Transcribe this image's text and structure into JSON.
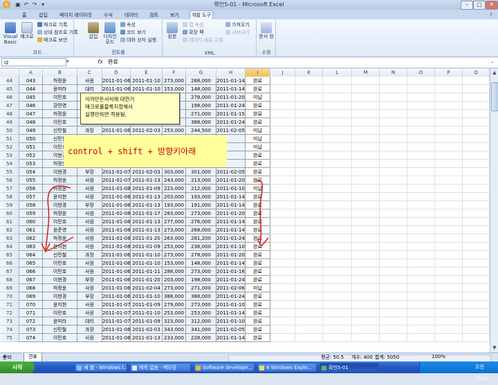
{
  "window": {
    "title": "확인5-01 - Microsoft Excel"
  },
  "tabs": [
    "홈",
    "삽입",
    "페이지 레이아웃",
    "수식",
    "데이터",
    "검토",
    "보기",
    "개발 도구"
  ],
  "active_tab": "개발 도구",
  "ribbon": {
    "code_group": {
      "label": "코드",
      "visual_basic": "Visual Basic",
      "macro": "매크로",
      "record_macro": "매크로 기록",
      "relative_ref": "상대 참조로 기록",
      "macro_security": "매크로 보안"
    },
    "controls_group": {
      "label": "컨트롤",
      "insert": "삽입",
      "design_mode": "디자인 모드",
      "properties": "속성",
      "view_code": "코드 보기",
      "run_dialog": "대화 상자 실행"
    },
    "xml_group": {
      "label": "XML",
      "source": "원본",
      "map_props": "맵 속성",
      "expansion_pack": "확장 팩",
      "refresh_data": "데이터 새로 고침",
      "import": "가져오기",
      "export": "내보내기"
    },
    "modify_group": {
      "label": "수정",
      "doc_panel": "문서 창"
    }
  },
  "formula_bar": {
    "name_box": "I2",
    "fx": "fx",
    "content": "완료"
  },
  "columns": [
    "A",
    "B",
    "C",
    "D",
    "E",
    "F",
    "G",
    "H",
    "I",
    "J",
    "K",
    "L",
    "M",
    "N",
    "O",
    "P",
    "Q"
  ],
  "rows": [
    {
      "n": "44",
      "a": "043",
      "b": "허정윤",
      "c": "사원",
      "d": "2011-01-06",
      "e": "2011-01-10",
      "f": "273,000",
      "g": "268,000",
      "h": "2011-01-14",
      "i": "완료"
    },
    {
      "n": "45",
      "a": "044",
      "b": "윤미라",
      "c": "대리",
      "d": "2011-01-06",
      "e": "2011-01-10",
      "f": "153,000",
      "g": "148,000",
      "h": "2011-01-14",
      "i": "완료"
    },
    {
      "n": "46",
      "a": "045",
      "b": "이민호",
      "c": "",
      "d": "",
      "e": "",
      "f": "",
      "g": "278,000",
      "h": "2011-01-20",
      "i": "미납"
    },
    {
      "n": "47",
      "a": "046",
      "b": "강민영",
      "c": "",
      "d": "",
      "e": "",
      "f": "",
      "g": "198,000",
      "h": "2011-01-24",
      "i": "완료"
    },
    {
      "n": "48",
      "a": "047",
      "b": "허정윤",
      "c": "",
      "d": "",
      "e": "",
      "f": "",
      "g": "271,000",
      "h": "2011-01-15",
      "i": "완료"
    },
    {
      "n": "49",
      "a": "048",
      "b": "이민호",
      "c": "",
      "d": "",
      "e": "",
      "f": "",
      "g": "388,000",
      "h": "2011-01-24",
      "i": "완료"
    },
    {
      "n": "50",
      "a": "049",
      "b": "신민철",
      "c": "과장",
      "d": "2011-01-06",
      "e": "2011-02-03",
      "f": "253,000",
      "g": "244,500",
      "h": "2011-02-05",
      "i": "미납"
    },
    {
      "n": "51",
      "a": "050",
      "b": "신민철",
      "c": "",
      "d": "",
      "e": "",
      "f": "",
      "g": "",
      "h": "",
      "i": "미납"
    },
    {
      "n": "52",
      "a": "051",
      "b": "이민호",
      "c": "",
      "d": "",
      "e": "",
      "f": "",
      "g": "",
      "h": "",
      "i": "미납"
    },
    {
      "n": "53",
      "a": "052",
      "b": "이현경",
      "c": "",
      "d": "",
      "e": "",
      "f": "",
      "g": "",
      "h": "",
      "i": "완료"
    },
    {
      "n": "54",
      "a": "053",
      "b": "허정윤",
      "c": "",
      "d": "",
      "e": "",
      "f": "",
      "g": "",
      "h": "",
      "i": "완료"
    },
    {
      "n": "55",
      "a": "054",
      "b": "이현경",
      "c": "부장",
      "d": "2011-01-07",
      "e": "2011-02-03",
      "f": "303,000",
      "g": "301,000",
      "h": "2011-02-05",
      "i": "완료"
    },
    {
      "n": "56",
      "a": "055",
      "b": "허정윤",
      "c": "사원",
      "d": "2011-01-07",
      "e": "2011-01-13",
      "f": "243,000",
      "g": "213,000",
      "h": "2011-01-20",
      "i": "완료"
    },
    {
      "n": "57",
      "a": "056",
      "b": "허정윤",
      "c": "사원",
      "d": "2011-01-08",
      "e": "2011-01-09",
      "f": "223,000",
      "g": "212,000",
      "h": "2011-01-10",
      "i": "미납"
    },
    {
      "n": "58",
      "a": "057",
      "b": "윤지현",
      "c": "사원",
      "d": "2011-01-08",
      "e": "2011-01-13",
      "f": "203,000",
      "g": "193,000",
      "h": "2011-01-14",
      "i": "완료"
    },
    {
      "n": "59",
      "a": "058",
      "b": "이현경",
      "c": "부장",
      "d": "2011-01-08",
      "e": "2011-01-13",
      "f": "193,000",
      "g": "191,000",
      "h": "2011-01-14",
      "i": "완료"
    },
    {
      "n": "60",
      "a": "059",
      "b": "허정윤",
      "c": "사원",
      "d": "2011-01-08",
      "e": "2011-01-17",
      "f": "283,000",
      "g": "273,000",
      "h": "2011-01-20",
      "i": "완료"
    },
    {
      "n": "61",
      "a": "060",
      "b": "이민호",
      "c": "사원",
      "d": "2011-01-08",
      "e": "2011-01-13",
      "f": "277,000",
      "g": "276,000",
      "h": "2011-01-14",
      "i": "완료"
    },
    {
      "n": "62",
      "a": "061",
      "b": "윤준영",
      "c": "사원",
      "d": "2011-01-08",
      "e": "2011-01-13",
      "f": "273,000",
      "g": "268,000",
      "h": "2011-01-14",
      "i": "완료"
    },
    {
      "n": "63",
      "a": "062",
      "b": "허정윤",
      "c": "사원",
      "d": "2011-01-08",
      "e": "2011-01-20",
      "f": "263,000",
      "g": "281,200",
      "h": "2011-01-24",
      "i": "완료"
    },
    {
      "n": "64",
      "a": "063",
      "b": "윤지현",
      "c": "사원",
      "d": "2011-01-08",
      "e": "2011-01-09",
      "f": "253,000",
      "g": "238,000",
      "h": "2011-01-10",
      "i": "완료"
    },
    {
      "n": "65",
      "a": "064",
      "b": "신민철",
      "c": "과장",
      "d": "2011-01-06",
      "e": "2011-01-10",
      "f": "273,000",
      "g": "278,000",
      "h": "2011-01-20",
      "i": "완료"
    },
    {
      "n": "66",
      "a": "065",
      "b": "이민호",
      "c": "사원",
      "d": "2011-01-06",
      "e": "2011-01-10",
      "f": "153,000",
      "g": "148,000",
      "h": "2011-01-14",
      "i": "완료"
    },
    {
      "n": "67",
      "a": "066",
      "b": "이민호",
      "c": "사원",
      "d": "2011-01-06",
      "e": "2011-01-11",
      "f": "288,000",
      "g": "273,000",
      "h": "2011-01-16",
      "i": "완료"
    },
    {
      "n": "68",
      "a": "067",
      "b": "이현경",
      "c": "부장",
      "d": "2011-01-06",
      "e": "2011-01-20",
      "f": "203,000",
      "g": "198,000",
      "h": "2011-01-24",
      "i": "완료"
    },
    {
      "n": "69",
      "a": "068",
      "b": "허정윤",
      "c": "사원",
      "d": "2011-01-06",
      "e": "2011-02-04",
      "f": "273,000",
      "g": "271,000",
      "h": "2011-02-06",
      "i": "미납"
    },
    {
      "n": "70",
      "a": "069",
      "b": "이현경",
      "c": "부장",
      "d": "2011-01-06",
      "e": "2011-01-10",
      "f": "388,000",
      "g": "388,000",
      "h": "2011-01-24",
      "i": "완료"
    },
    {
      "n": "71",
      "a": "070",
      "b": "윤지현",
      "c": "사원",
      "d": "2011-01-07",
      "e": "2011-01-09",
      "f": "279,000",
      "g": "273,000",
      "h": "2011-01-10",
      "i": "완료"
    },
    {
      "n": "72",
      "a": "071",
      "b": "이민호",
      "c": "사원",
      "d": "2011-01-07",
      "e": "2011-01-10",
      "f": "253,000",
      "g": "253,000",
      "h": "2011-01-14",
      "i": "완료"
    },
    {
      "n": "73",
      "a": "072",
      "b": "윤미라",
      "c": "대리",
      "d": "2011-01-07",
      "e": "2011-01-09",
      "f": "323,000",
      "g": "312,000",
      "h": "2011-01-10",
      "i": "완료"
    },
    {
      "n": "74",
      "a": "073",
      "b": "신민철",
      "c": "과장",
      "d": "2011-01-08",
      "e": "2011-02-03",
      "f": "343,000",
      "g": "341,000",
      "h": "2011-02-05",
      "i": "완료"
    },
    {
      "n": "75",
      "a": "074",
      "b": "이민호",
      "c": "사원",
      "d": "2011-01-08",
      "e": "2011-01-13",
      "f": "233,000",
      "g": "228,000",
      "h": "2011-01-14",
      "i": "완료"
    }
  ],
  "note_small": {
    "line1": "이까만든서식에 대한거",
    "line2": "매크로를블록지정해서",
    "line3": "실행만하면 적용됨."
  },
  "note_big": "control + shift + 방향키아래",
  "sheet_tab": "견표",
  "status": {
    "ready": "준비",
    "average": "평균: 50.5",
    "count": "개수: 400",
    "sum": "합계: 5050",
    "zoom": "100%"
  },
  "taskbar": {
    "start": "시작",
    "items": [
      "새 탭 - Windows I...",
      "제목 없음 - 메모장",
      "Software develope...",
      "4 Windows Explo...",
      "확인5-01"
    ],
    "clock": "오전 10:01"
  }
}
